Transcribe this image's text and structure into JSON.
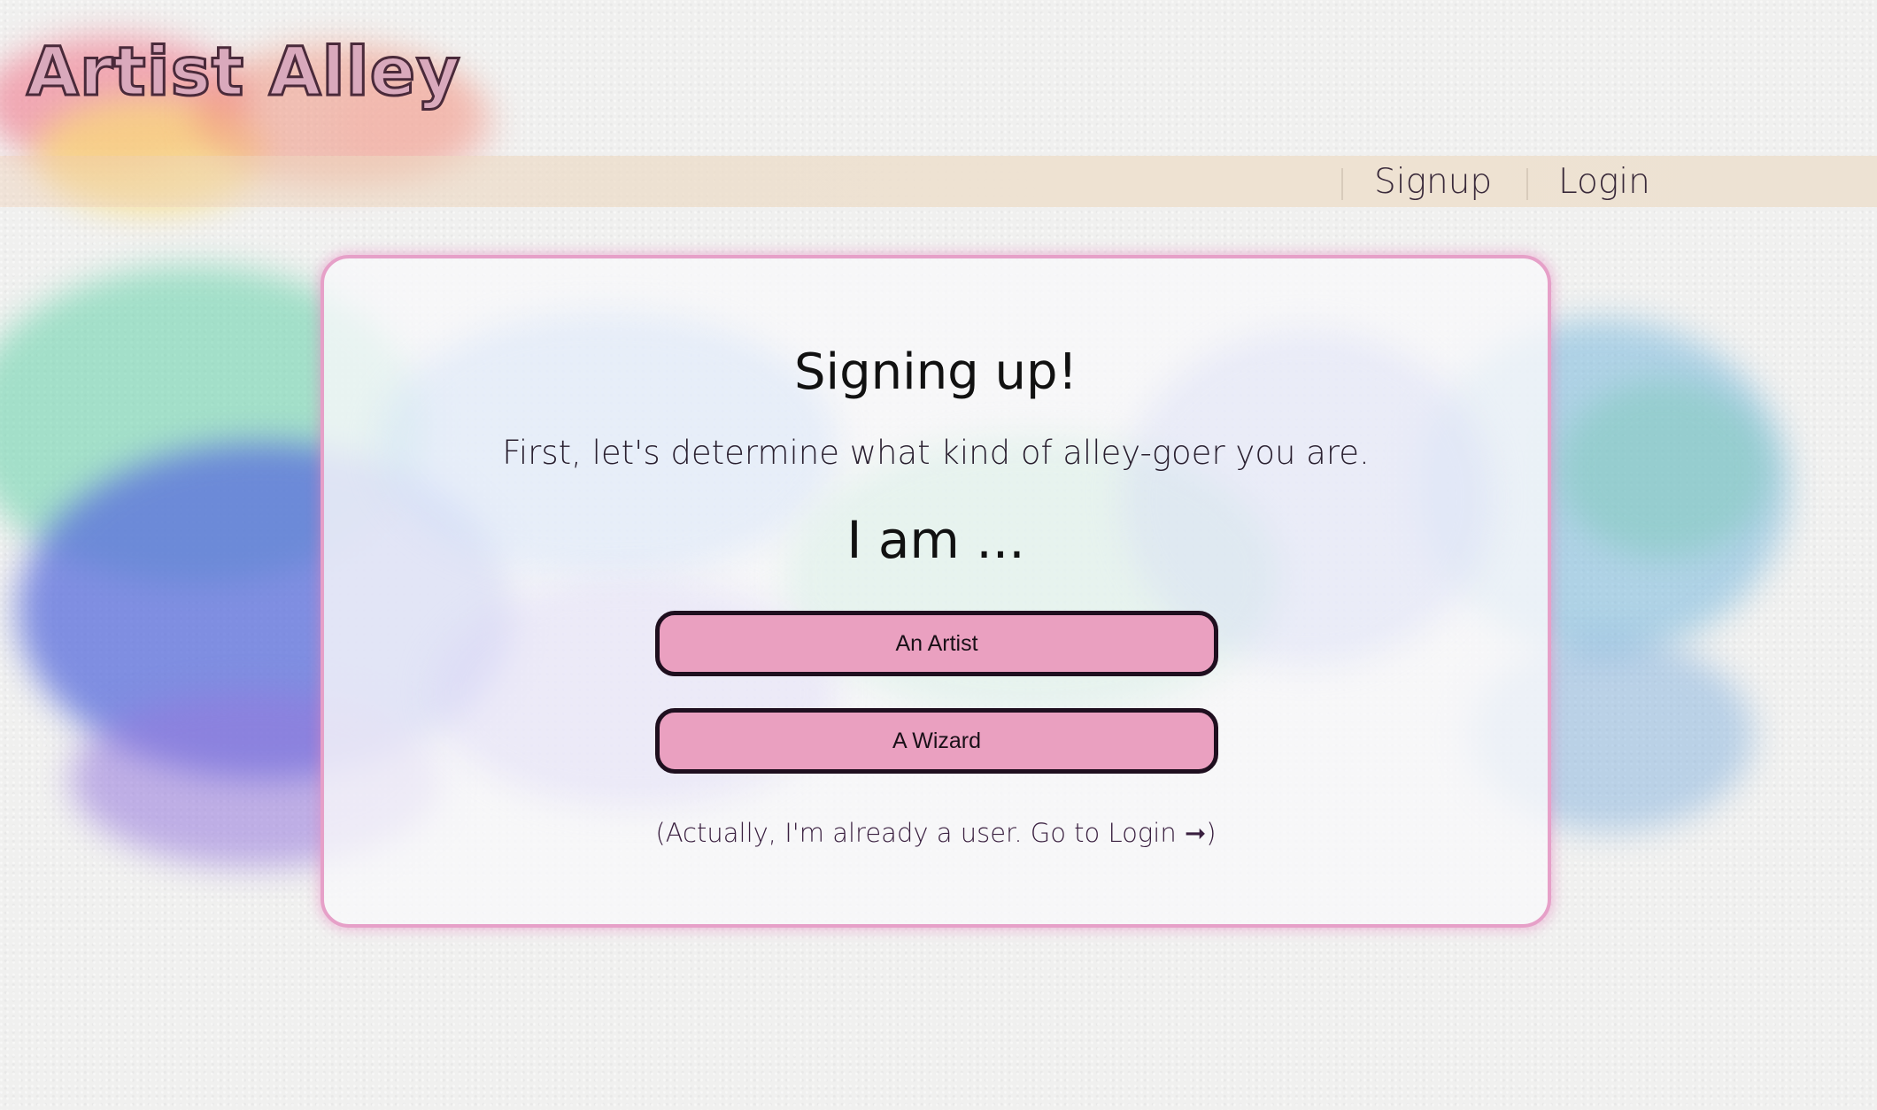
{
  "header": {
    "logo_text": "Artist Alley",
    "nav": [
      {
        "label": "Signup"
      },
      {
        "label": "Login"
      }
    ]
  },
  "card": {
    "title": "Signing up!",
    "intro": "First, let's determine what kind of alley-goer you are.",
    "prompt": "I am ...",
    "options": [
      {
        "label": "An Artist"
      },
      {
        "label": "A Wizard"
      }
    ],
    "login_link": "(Actually, I'm already a user. Go to Login ➞)"
  },
  "colors": {
    "button_fill": "#eaa0c0",
    "button_border": "#1f0f1f",
    "card_border": "#e6a0c8",
    "navbar": "#ede2d3"
  }
}
